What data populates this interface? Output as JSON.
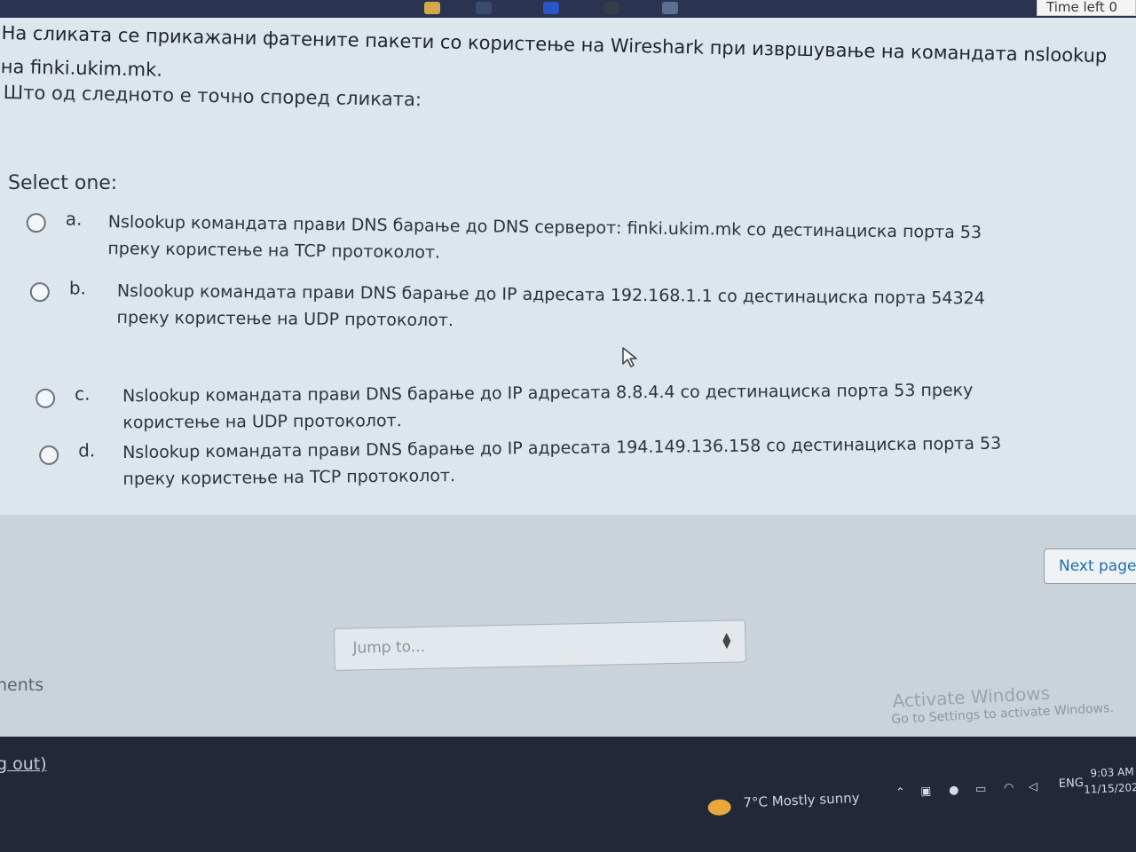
{
  "header": {
    "time_left_label": "Time left 0"
  },
  "question": {
    "text": "На сликата се прикажани фатените пакети со користење на Wireshark при извршување на командата nslookup на finki.ukim.mk.",
    "prompt": "Што од следното е точно според сликата:",
    "select_label": "Select one:"
  },
  "options": [
    {
      "letter": "a.",
      "text": "Nslookup командата прави DNS барање до DNS серверот: finki.ukim.mk со дестинациска порта 53 преку користење на TCP протоколот.",
      "selected": false
    },
    {
      "letter": "b.",
      "text": "Nslookup командата прави DNS барање до IP адресата 192.168.1.1 со дестинациска порта 54324 преку користење на UDP протоколот.",
      "selected": false
    },
    {
      "letter": "c.",
      "text": "Nslookup командата прави DNS барање до IP адресата 8.8.4.4 со дестинациска порта 53 преку користење на UDP протоколот.",
      "selected": false
    },
    {
      "letter": "d.",
      "text": "Nslookup командата прави DNS барање до IP адресата 194.149.136.158 со дестинациска порта 53 преку користење на TCP протоколот.",
      "selected": false
    }
  ],
  "navigation": {
    "next_label": "Next page",
    "jump_placeholder": "Jump to...",
    "left_link": "nents",
    "log_out": "g out)"
  },
  "activation": {
    "title": "Activate Windows",
    "subtitle": "Go to Settings to activate Windows."
  },
  "taskbar": {
    "weather": "7°C  Mostly sunny",
    "language": "ENG",
    "time": "9:03 AM",
    "date": "11/15/202"
  }
}
